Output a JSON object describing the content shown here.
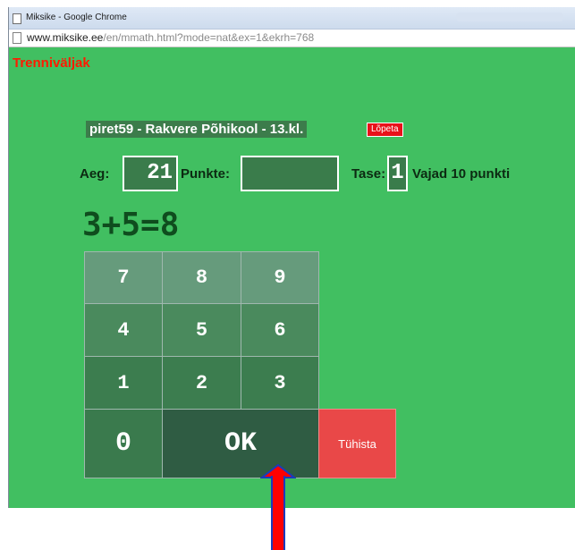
{
  "browser": {
    "window_title": "Miksike - Google Chrome",
    "url_host": "www.miksike.ee",
    "url_path": "/en/mmath.html?mode=nat&ex=1&ekrh=768"
  },
  "page": {
    "title": "Trenniväljak",
    "user_info": "piret59 - Rakvere Põhikool - 13.kl.",
    "quit_label": "Lõpeta",
    "time_label": "Aeg:",
    "time_value": "21",
    "points_label": "Punkte:",
    "points_value": "",
    "level_label": "Tase:",
    "level_value": "1",
    "needed_text": "Vajad 10 punkti",
    "equation": "3+5=8"
  },
  "keypad": {
    "k7": "7",
    "k8": "8",
    "k9": "9",
    "k4": "4",
    "k5": "5",
    "k6": "6",
    "k1": "1",
    "k2": "2",
    "k3": "3",
    "k0": "0",
    "ok": "OK",
    "cancel": "Tühista"
  },
  "colors": {
    "page_background": "#41bf61",
    "title_color": "#ff1a00",
    "quit_button": "#e8111a",
    "cancel_button": "#e94848",
    "annotation_arrow": "#ff0000"
  },
  "icons": {
    "title_icon": "page-icon",
    "address_icon": "page-icon",
    "annotation": "red-up-arrow"
  }
}
